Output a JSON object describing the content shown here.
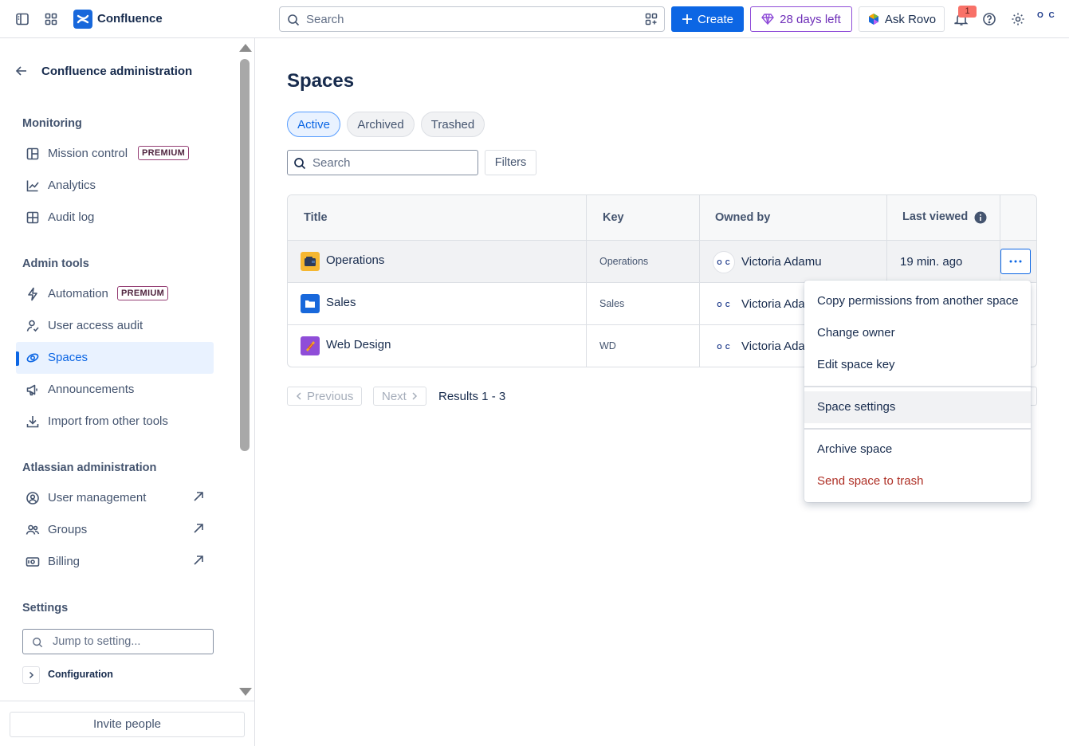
{
  "topbar": {
    "brand": "Confluence",
    "search_placeholder": "Search",
    "create_label": "Create",
    "trial_label": "28 days left",
    "rovo_label": "Ask Rovo",
    "notification_count": "1",
    "avatar_text": "O C"
  },
  "sidebar": {
    "title": "Confluence administration",
    "sections": {
      "monitoring": "Monitoring",
      "admin_tools": "Admin tools",
      "atlassian_admin": "Atlassian administration",
      "settings": "Settings"
    },
    "items": {
      "mission_control": "Mission control",
      "analytics": "Analytics",
      "audit_log": "Audit log",
      "automation": "Automation",
      "user_access_audit": "User access audit",
      "spaces": "Spaces",
      "announcements": "Announcements",
      "import": "Import from other tools",
      "user_management": "User management",
      "groups": "Groups",
      "billing": "Billing"
    },
    "premium_badge": "PREMIUM",
    "jump_placeholder": "Jump to setting...",
    "configuration": "Configuration",
    "invite": "Invite people"
  },
  "main": {
    "title": "Spaces",
    "tabs": [
      "Active",
      "Archived",
      "Trashed"
    ],
    "search_placeholder": "Search",
    "filters": "Filters",
    "columns": [
      "Title",
      "Key",
      "Owned by",
      "Last viewed"
    ],
    "rows": [
      {
        "title": "Operations",
        "key": "Operations",
        "owner": "Victoria Adamu",
        "viewed": "19 min. ago"
      },
      {
        "title": "Sales",
        "key": "Sales",
        "owner": "Victoria Ada",
        "viewed": ""
      },
      {
        "title": "Web Design",
        "key": "WD",
        "owner": "Victoria Ada",
        "viewed": ""
      }
    ],
    "owner_avatar": "O C",
    "previous": "Previous",
    "next": "Next",
    "results": "Results 1 - 3"
  },
  "menu": {
    "items": [
      "Copy permissions from another space",
      "Change owner",
      "Edit space key",
      "Space settings",
      "Archive space",
      "Send space to trash"
    ]
  },
  "colors": {
    "brand": "#1868db",
    "primary": "#0c66e4",
    "danger": "#ae2e24",
    "trial": "#6e2fb8"
  }
}
